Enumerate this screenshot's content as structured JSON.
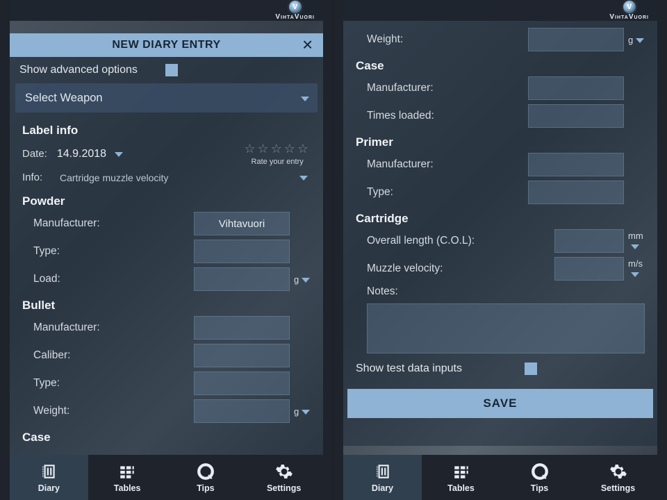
{
  "brand": {
    "name": "VihtaVuori",
    "logo_letter": "V"
  },
  "left": {
    "modal_title": "NEW DIARY ENTRY",
    "adv_label": "Show advanced options",
    "select_weapon": "Select Weapon",
    "sections": {
      "label_info": "Label info",
      "powder": "Powder",
      "bullet": "Bullet",
      "case": "Case"
    },
    "date": {
      "label": "Date:",
      "value": "14.9.2018"
    },
    "rate": {
      "sub": "Rate your entry"
    },
    "info": {
      "label": "Info:",
      "selected": "Cartridge muzzle velocity"
    },
    "fields": {
      "manufacturer": "Manufacturer:",
      "type": "Type:",
      "load": "Load:",
      "caliber": "Caliber:",
      "weight": "Weight:"
    },
    "units": {
      "g": "g"
    },
    "powder_manufacturer_value": "Vihtavuori"
  },
  "right": {
    "weight_label": "Weight:",
    "units": {
      "g": "g",
      "mm": "mm",
      "ms": "m/s"
    },
    "sections": {
      "case": "Case",
      "primer": "Primer",
      "cartridge": "Cartridge"
    },
    "fields": {
      "manufacturer": "Manufacturer:",
      "times_loaded": "Times loaded:",
      "type": "Type:",
      "col": "Overall length (C.O.L):",
      "muzzle": "Muzzle velocity:",
      "notes": "Notes:"
    },
    "show_test": "Show test data inputs",
    "save": "SAVE"
  },
  "tabs": {
    "diary": "Diary",
    "tables": "Tables",
    "tips": "Tips",
    "settings": "Settings"
  }
}
